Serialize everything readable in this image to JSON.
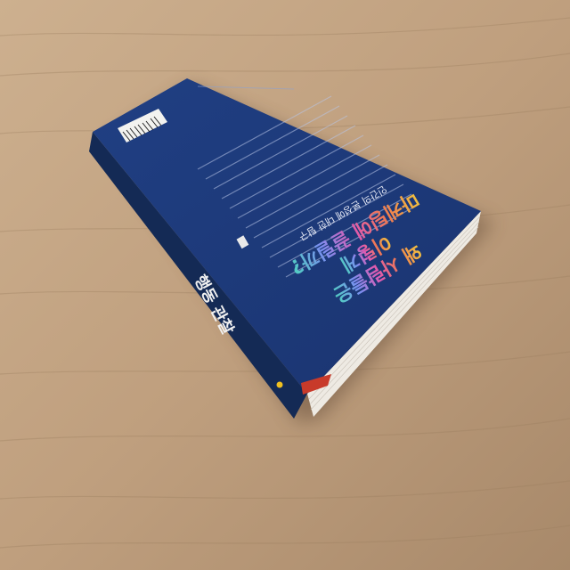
{
  "photo": {
    "subject": "book-back-cover-on-wooden-table",
    "colors": {
      "table_light": "#c9ab8a",
      "table_dark": "#a98a6a",
      "cover": "#1f3c7e",
      "cover_dark": "#16305f",
      "spine": "#142a55",
      "pages": "#eeeae3",
      "price_red": "#c83a2a"
    }
  },
  "cover": {
    "headline_line1": "왜 사람들은",
    "headline_line2": "이렇게",
    "headline_line3": "마케팅에 끌릴까?",
    "subtitle": "인간의 본성에 대한 탐구"
  },
  "spine": {
    "title": "행동 관찰"
  }
}
